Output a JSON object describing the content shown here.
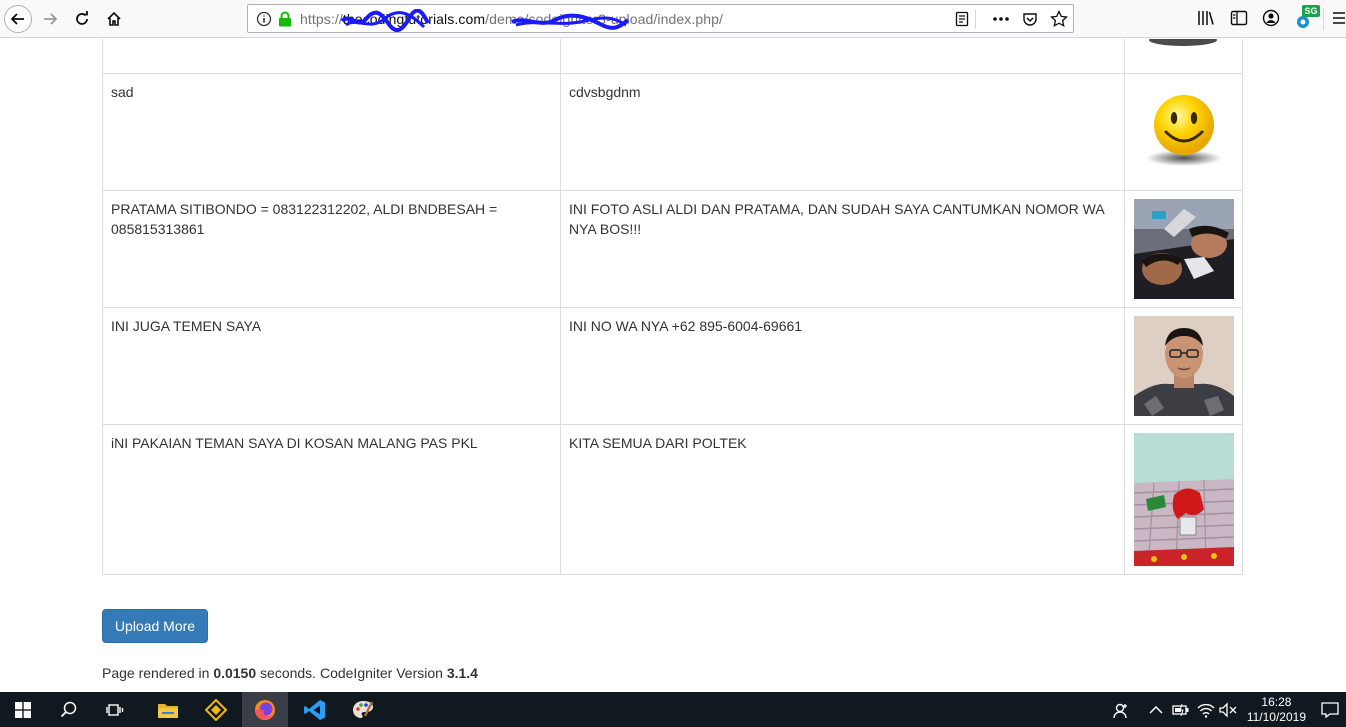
{
  "browser": {
    "url_scheme": "https://",
    "url_host": "thecodingtutorials.com",
    "url_path": "/demo/codeigniter3-upload/index.php/",
    "profile_badge": "SG"
  },
  "rows": [
    {
      "title": "",
      "description": "",
      "image": "smiley-partial"
    },
    {
      "title": "sad",
      "description": "cdvsbgdnm",
      "image": "smiley"
    },
    {
      "title": "PRATAMA SITIBONDO = 083122312202, ALDI BNDBESAH = 085815313861",
      "description": "INI FOTO ASLI ALDI DAN PRATAMA, DAN SUDAH SAYA CANTUMKAN NOMOR WA NYA BOS!!!",
      "image": "photo-selfie"
    },
    {
      "title": "INI JUGA TEMEN SAYA",
      "description": "INI NO WA NYA +62 895-6004-69661",
      "image": "photo-portrait"
    },
    {
      "title": "iNI PAKAIAN TEMAN SAYA DI KOSAN MALANG PAS PKL",
      "description": "KITA SEMUA DARI POLTEK",
      "image": "photo-clothes"
    }
  ],
  "upload_button": "Upload More",
  "footer": {
    "prefix": "Page rendered in ",
    "time": "0.0150",
    "middle": " seconds. CodeIgniter Version ",
    "version": "3.1.4"
  },
  "taskbar": {
    "time": "16:28",
    "date": "11/10/2019"
  }
}
